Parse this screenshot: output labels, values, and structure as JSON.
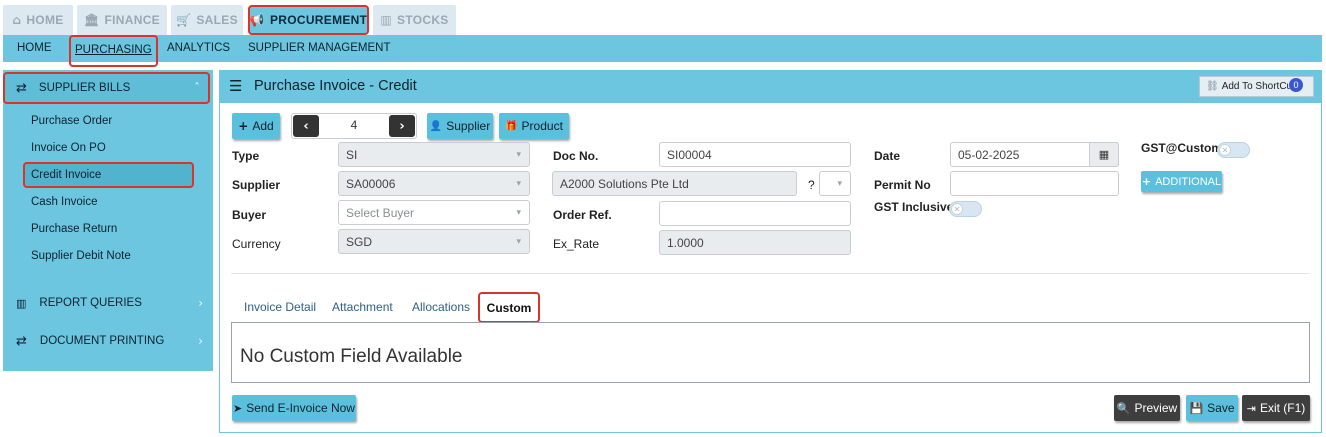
{
  "top_tabs": [
    {
      "label": "HOME",
      "icon": "home-icon"
    },
    {
      "label": "FINANCE",
      "icon": "bank-icon"
    },
    {
      "label": "SALES",
      "icon": "cart-icon"
    },
    {
      "label": "PROCUREMENT",
      "icon": "megaphone-icon"
    },
    {
      "label": "STOCKS",
      "icon": "bar-chart-icon"
    }
  ],
  "sub_nav": [
    "HOME",
    "PURCHASING",
    "ANALYTICS",
    "SUPPLIER MANAGEMENT"
  ],
  "sidebar": {
    "section_supplier_bills": "SUPPLIER BILLS",
    "items": [
      "Purchase Order",
      "Invoice On PO",
      "Credit Invoice",
      "Cash Invoice",
      "Purchase Return",
      "Supplier Debit Note"
    ],
    "section_report_queries": "REPORT QUERIES",
    "section_document_printing": "DOCUMENT PRINTING"
  },
  "panel": {
    "title": "Purchase Invoice - Credit",
    "shortcut_label": "Add To ShortCut",
    "shortcut_badge": "0"
  },
  "toolbar": {
    "add_label": "Add",
    "record_number": "4",
    "supplier_label": "Supplier",
    "product_label": "Product"
  },
  "form": {
    "type_label": "Type",
    "type_value": "SI",
    "supplier_label": "Supplier",
    "supplier_code": "SA00006",
    "supplier_name": "A2000 Solutions Pte Ltd",
    "question_mark": "?",
    "buyer_label": "Buyer",
    "buyer_placeholder": "Select Buyer",
    "currency_label": "Currency",
    "currency_value": "SGD",
    "docno_label": "Doc No.",
    "docno_value": "SI00004",
    "orderref_label": "Order Ref.",
    "orderref_value": "",
    "exrate_label": "Ex_Rate",
    "exrate_value": "1.0000",
    "date_label": "Date",
    "date_value": "05-02-2025",
    "permit_label": "Permit No",
    "permit_value": "",
    "gst_inclusive_label": "GST Inclusive",
    "gst_custom_label": "GST@Custom",
    "additional_label": "ADDITIONAL"
  },
  "tabs": [
    "Invoice Detail",
    "Attachment",
    "Allocations",
    "Custom"
  ],
  "custom_message": "No Custom Field Available",
  "footer": {
    "send_einvoice_label": "Send E-Invoice Now",
    "preview_label": "Preview",
    "save_label": "Save",
    "exit_label": "Exit (F1)"
  },
  "colors": {
    "accent": "#6cc6df",
    "button": "#5bc0de",
    "highlight": "#d9342b",
    "dark_button": "#3e3e3e"
  }
}
